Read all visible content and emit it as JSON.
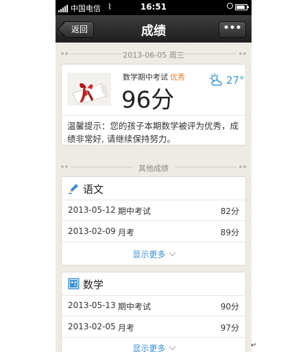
{
  "status_bar": {
    "carrier": "中国电信",
    "time": "16:51"
  },
  "navbar": {
    "back_label": "返回",
    "title": "成绩",
    "more_label": "•••"
  },
  "latest": {
    "date_label": "2013-06-05 周三",
    "exam_name": "数学期中考试",
    "rating": "优秀",
    "score": "96分",
    "weather": {
      "icon": "partly-cloudy-icon",
      "temperature": "27°"
    },
    "tip": "温馨提示：您的孩子本期数学被评为优秀，成绩非常好, 请继续保持努力。"
  },
  "other_section_label": "其他成绩",
  "subjects": [
    {
      "name": "语文",
      "icon": "pen-icon",
      "records": [
        {
          "date": "2013-05-12",
          "exam": "期中考试",
          "score": "82分"
        },
        {
          "date": "2013-02-09",
          "exam": "月考",
          "score": "89分"
        }
      ],
      "more_label": "显示更多"
    },
    {
      "name": "数学",
      "icon": "math-icon",
      "records": [
        {
          "date": "2013-05-13",
          "exam": "期中考试",
          "score": "90分"
        },
        {
          "date": "2013-02-05",
          "exam": "月考",
          "score": "97分"
        }
      ],
      "more_label": "显示更多"
    }
  ],
  "colors": {
    "accent_blue": "#3a8fd6",
    "rating_orange": "#f07826",
    "background": "#eeebe4"
  }
}
